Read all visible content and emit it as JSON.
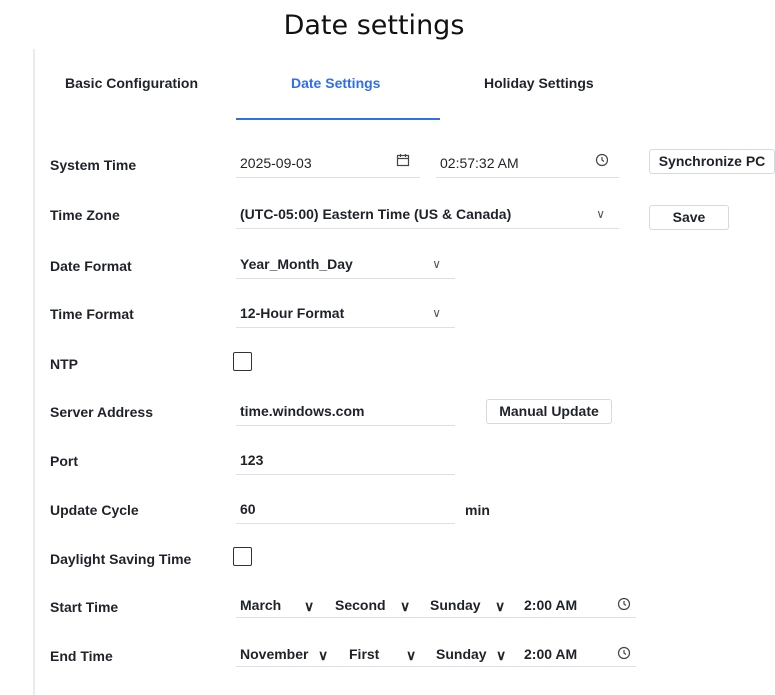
{
  "page": {
    "title": "Date settings"
  },
  "tabs": [
    {
      "label": "Basic Configuration",
      "active": false
    },
    {
      "label": "Date Settings",
      "active": true
    },
    {
      "label": "Holiday Settings",
      "active": false
    }
  ],
  "colors": {
    "accent": "#2f6fe8",
    "text": "#1f2329",
    "border": "#dcdfe6"
  },
  "system_time": {
    "label": "System Time",
    "date": "2025-09-03",
    "date_icon": "calendar-icon",
    "time": "02:57:32 AM",
    "time_icon": "clock-icon",
    "sync_button": "Synchronize PC"
  },
  "time_zone": {
    "label": "Time Zone",
    "value": "(UTC-05:00) Eastern Time (US & Canada)",
    "save_button": "Save"
  },
  "date_format": {
    "label": "Date Format",
    "value": "Year_Month_Day"
  },
  "time_format": {
    "label": "Time Format",
    "value": "12-Hour Format"
  },
  "ntp": {
    "label": "NTP",
    "checked": false
  },
  "server_address": {
    "label": "Server Address",
    "value": "time.windows.com",
    "update_button": "Manual Update"
  },
  "port": {
    "label": "Port",
    "value": "123"
  },
  "update_cycle": {
    "label": "Update Cycle",
    "value": "60",
    "unit": "min"
  },
  "dst": {
    "label": "Daylight Saving Time",
    "checked": false
  },
  "start_time": {
    "label": "Start Time",
    "month": "March",
    "week": "Second",
    "day": "Sunday",
    "time": "2:00 AM"
  },
  "end_time": {
    "label": "End Time",
    "month": "November",
    "week": "First",
    "day": "Sunday",
    "time": "2:00 AM"
  },
  "glyphs": {
    "chevron": "∨",
    "calendar": "📅",
    "clock": "🕓"
  }
}
